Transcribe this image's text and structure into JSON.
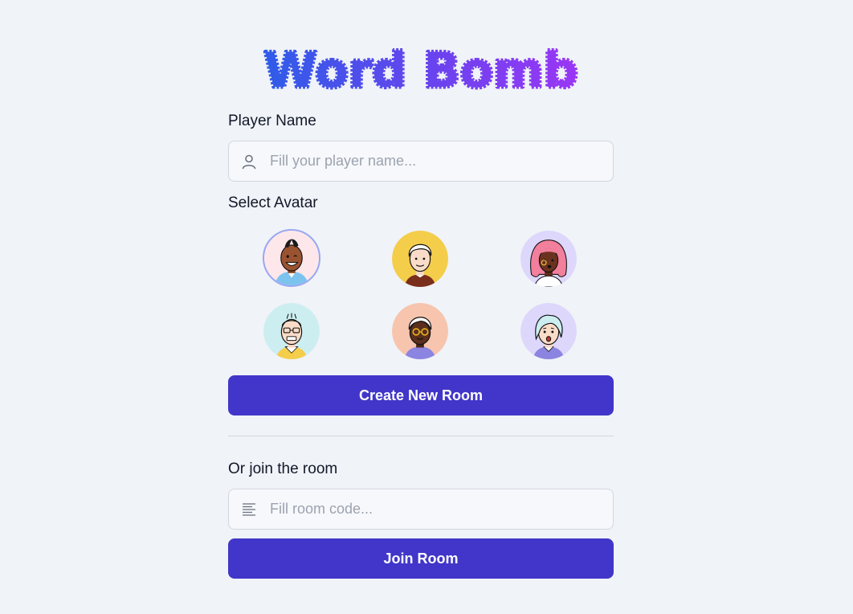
{
  "app": {
    "title": "Word Bomb",
    "brand_gradient": [
      "#2f5ce8",
      "#7b3ff0",
      "#9a36f5"
    ]
  },
  "player_name": {
    "label": "Player Name",
    "placeholder": "Fill your player name...",
    "value": "",
    "icon": "user-icon"
  },
  "avatar": {
    "label": "Select Avatar",
    "selected_index": 0,
    "options": [
      {
        "id": "avatar-1",
        "bg": "#fde7ea"
      },
      {
        "id": "avatar-2",
        "bg": "#f4cd4a"
      },
      {
        "id": "avatar-3",
        "bg": "#ddd7fb"
      },
      {
        "id": "avatar-4",
        "bg": "#cdeef0"
      },
      {
        "id": "avatar-5",
        "bg": "#f7c4ad"
      },
      {
        "id": "avatar-6",
        "bg": "#ddd7fb"
      }
    ]
  },
  "create_room": {
    "label": "Create New Room",
    "color": "#4136c9"
  },
  "join_room": {
    "label": "Or join the room",
    "placeholder": "Fill room code...",
    "value": "",
    "icon": "code-lines-icon",
    "button_label": "Join Room",
    "color": "#4136c9"
  }
}
